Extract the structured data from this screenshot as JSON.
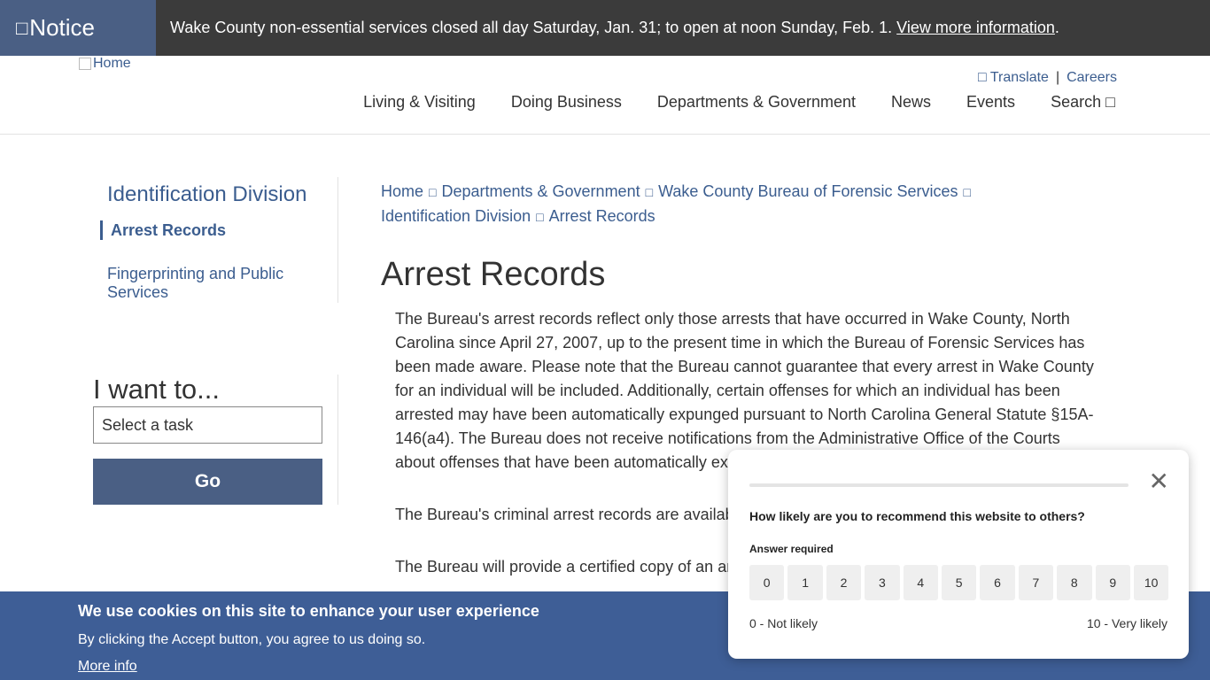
{
  "notice": {
    "tag_icon": "□",
    "tag": "Notice",
    "text": "Wake County non-essential services closed all day Saturday, Jan. 31; to open at noon Sunday, Feb. 1.",
    "link": "View more information",
    "trail": "."
  },
  "header": {
    "logo_alt": "Home",
    "translate_icon": "□",
    "translate": "Translate",
    "separator": "|",
    "careers": "Careers",
    "nav": [
      "Living & Visiting",
      "Doing Business",
      "Departments & Government",
      "News",
      "Events"
    ],
    "search": "Search",
    "search_icon": "□"
  },
  "sidebar": {
    "title": "Identification Division",
    "active": "Arrest Records",
    "item": "Fingerprinting and Public Services"
  },
  "iwant": {
    "title": "I want to...",
    "select": "Select a task",
    "go": "Go"
  },
  "breadcrumb": {
    "sep": "□",
    "items": [
      "Home",
      "Departments & Government",
      "Wake County Bureau of Forensic Services",
      "Identification Division",
      "Arrest Records"
    ]
  },
  "content": {
    "title": "Arrest Records",
    "p1": "The Bureau's arrest records reflect only those arrests that have occurred in Wake County, North Carolina since April 27, 2007, up to the present time in which the Bureau of Forensic Services has been made aware. Please note that the Bureau cannot guarantee that every arrest in Wake County for an individual will be included. Additionally, certain offenses for which an individual has been arrested may have been automatically expunged pursuant to North Carolina General Statute §15A-146(a4). The Bureau does not receive notifications from the Administrative Office of the Courts about offenses that have been automatically ex",
    "p2": "The Bureau's criminal arrest records are availab",
    "p3": "The Bureau will provide a certified copy of an ar Bureau's online public database provides the sa"
  },
  "cookie": {
    "title": "We use cookies on this site to enhance your user experience",
    "text": "By clicking the Accept button, you agree to us doing so.",
    "more": "More info"
  },
  "survey": {
    "close": "✕",
    "question": "How likely are you to recommend this website to others?",
    "required": "Answer required",
    "options": [
      "0",
      "1",
      "2",
      "3",
      "4",
      "5",
      "6",
      "7",
      "8",
      "9",
      "10"
    ],
    "low_label": "0 - Not likely",
    "high_label": "10 - Very likely"
  }
}
